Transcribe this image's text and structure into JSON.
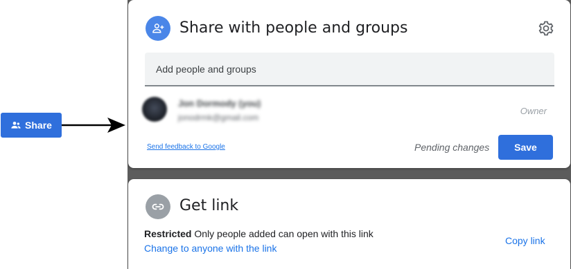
{
  "trigger": {
    "share_label": "Share"
  },
  "dialog": {
    "title": "Share with people and groups",
    "add_placeholder": "Add people and groups",
    "person": {
      "name": "Jon Dormody (you)",
      "email": "jonodrmk@gmail.com",
      "role": "Owner"
    },
    "feedback_link": "Send feedback to Google",
    "pending_text": "Pending changes",
    "save_label": "Save"
  },
  "get_link": {
    "title": "Get link",
    "restricted_label": "Restricted",
    "restricted_desc": "Only people added can open with this link",
    "change_link": "Change to anyone with the link",
    "copy_link": "Copy link"
  },
  "colors": {
    "primary": "#2f6fdc",
    "link": "#1a73e8",
    "backdrop": "#5c5c5c"
  },
  "icons": {
    "share": "person-add-icon",
    "settings": "gear-icon",
    "link": "link-icon"
  }
}
